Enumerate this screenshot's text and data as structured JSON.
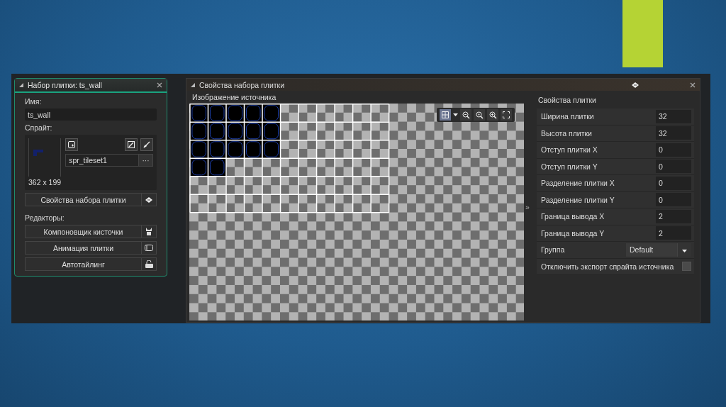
{
  "tileset_panel": {
    "title": "Набор плитки: ts_wall",
    "name_label": "Имя:",
    "name_value": "ts_wall",
    "sprite_label": "Спрайт:",
    "sprite_size": "362 x 199",
    "sprite_name": "spr_tileset1",
    "browse_button": "···",
    "properties_button": "Свойства набора плитки",
    "editors_label": "Редакторы:",
    "editors": [
      {
        "label": "Компоновщик кисточки",
        "kind": "brush"
      },
      {
        "label": "Анимация плитки",
        "kind": "animation"
      },
      {
        "label": "Автотайлинг",
        "kind": "autotile"
      }
    ]
  },
  "properties_window": {
    "title": "Свойства набора плитки",
    "splitter_glyph": "»",
    "source_image": {
      "title": "Изображение источника",
      "grid_on": true
    },
    "tile_properties": {
      "title": "Свойства плитки",
      "fields": [
        {
          "label": "Ширина плитки",
          "value": "32"
        },
        {
          "label": "Высота плитки",
          "value": "32"
        },
        {
          "label": "Отступ плитки X",
          "value": "0"
        },
        {
          "label": "Отступ плитки Y",
          "value": "0"
        },
        {
          "label": "Разделение плитки X",
          "value": "0"
        },
        {
          "label": "Разделение плитки Y",
          "value": "0"
        },
        {
          "label": "Граница вывода X",
          "value": "2"
        },
        {
          "label": "Граница вывода Y",
          "value": "2"
        }
      ],
      "group": {
        "label": "Группа",
        "value": "Default"
      },
      "disable_export": {
        "label": "Отключить экспорт спрайта источника",
        "checked": false
      }
    }
  }
}
